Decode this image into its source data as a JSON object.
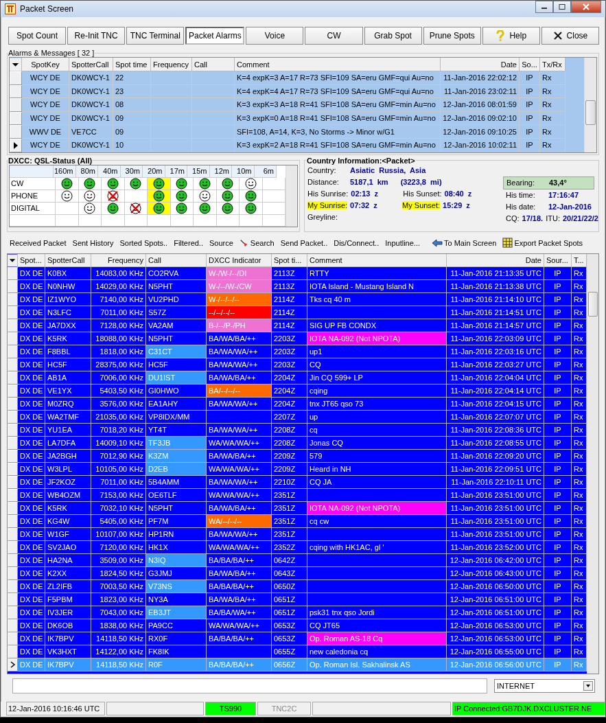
{
  "window": {
    "title": "Packet Screen"
  },
  "toolbar": [
    {
      "label": "Spot Count",
      "kind": "plain",
      "selected": false
    },
    {
      "label": "Re-Init TNC",
      "kind": "plain",
      "selected": false
    },
    {
      "label": "TNC Terminal",
      "kind": "plain",
      "selected": false
    },
    {
      "label": "Packet Alarms",
      "kind": "plain",
      "selected": true
    },
    {
      "label": "Voice",
      "kind": "plain",
      "selected": false
    },
    {
      "label": "CW",
      "kind": "plain",
      "selected": false
    },
    {
      "label": "Grab Spot",
      "kind": "plain",
      "selected": false
    },
    {
      "label": "Prune Spots",
      "kind": "plain",
      "selected": false
    },
    {
      "label": "Help",
      "kind": "help",
      "selected": false
    },
    {
      "label": "Close",
      "kind": "close",
      "selected": false
    }
  ],
  "alarms": {
    "title": "Alarms & Messages [ 32 ]",
    "columns": [
      "SpotKey",
      "SpotterCall",
      "Spot time",
      "Frequency",
      "Call",
      "Comment",
      "Date",
      "So...",
      "Tx/Rx"
    ],
    "rows": [
      {
        "cells": [
          "WCY DE",
          "DK0WCY-1",
          "22",
          "",
          "",
          "K=4 expK=3 A=17 R=73 SFI=109 SA=eru GMF=qui Au=no",
          "11-Jan-2016 22:02:12",
          "IP",
          "Rx"
        ],
        "selected": false
      },
      {
        "cells": [
          "WCY DE",
          "DK0WCY-1",
          "23",
          "",
          "",
          "K=4 expK=4 A=17 R=73 SFI=109 SA=eru GMF=qui Au=no",
          "11-Jan-2016 23:02:11",
          "IP",
          "Rx"
        ],
        "selected": false
      },
      {
        "cells": [
          "WCY DE",
          "DK0WCY-1",
          "08",
          "",
          "",
          "K=3 expK=3 A=18 R=41 SFI=108 SA=eru GMF=min Au=no",
          "12-Jan-2016 08:01:59",
          "IP",
          "Rx"
        ],
        "selected": false
      },
      {
        "cells": [
          "WCY DE",
          "DK0WCY-1",
          "09",
          "",
          "",
          "K=3 expK=0 A=18 R=41 SFI=108 SA=eru GMF=min Au=no",
          "12-Jan-2016 09:02:10",
          "IP",
          "Rx"
        ],
        "selected": false
      },
      {
        "cells": [
          "WWV DE",
          "VE7CC",
          "09",
          "",
          "",
          "SFI=108, A=14, K=3, No Storms -> Minor w/G1",
          "12-Jan-2016 09:10:25",
          "IP",
          "Rx"
        ],
        "selected": false
      },
      {
        "cells": [
          "WCY DE",
          "DK0WCY-1",
          "10",
          "",
          "",
          "K=3 expK=2 A=18 R=41 SFI=108 SA=eru GMF=min Au=no",
          "12-Jan-2016 10:02:11",
          "IP",
          "Rx"
        ],
        "selected": true
      }
    ]
  },
  "dxcc": {
    "title": "DXCC: QSL-Status  (All)",
    "bands": [
      {
        "label": "160m",
        "selected": false
      },
      {
        "label": "80m",
        "selected": false
      },
      {
        "label": "40m",
        "selected": false
      },
      {
        "label": "30m",
        "selected": false
      },
      {
        "label": "20m",
        "selected": true
      },
      {
        "label": "17m",
        "selected": false
      },
      {
        "label": "15m",
        "selected": false
      },
      {
        "label": "12m",
        "selected": false
      },
      {
        "label": "10m",
        "selected": false
      },
      {
        "label": "6m",
        "selected": false
      }
    ],
    "modes": [
      {
        "label": "CW",
        "cells": [
          {
            "kind": "confirmed"
          },
          {
            "kind": "confirmed"
          },
          {
            "kind": "confirmed"
          },
          {
            "kind": "confirmed"
          },
          {
            "kind": "confirmed"
          },
          {
            "kind": "confirmed"
          },
          {
            "kind": "confirmed"
          },
          {
            "kind": "confirmed"
          },
          {
            "kind": "worked"
          },
          {
            "kind": "empty"
          }
        ]
      },
      {
        "label": "PHONE",
        "cells": [
          {
            "kind": "worked"
          },
          {
            "kind": "worked"
          },
          {
            "kind": "missing"
          },
          {
            "kind": "empty"
          },
          {
            "kind": "confirmed"
          },
          {
            "kind": "confirmed"
          },
          {
            "kind": "worked"
          },
          {
            "kind": "confirmed"
          },
          {
            "kind": "confirmed"
          },
          {
            "kind": "empty"
          }
        ]
      },
      {
        "label": "DIGITAL",
        "cells": [
          {
            "kind": "empty"
          },
          {
            "kind": "worked"
          },
          {
            "kind": "confirmed"
          },
          {
            "kind": "missing"
          },
          {
            "kind": "confirmed"
          },
          {
            "kind": "confirmed"
          },
          {
            "kind": "confirmed"
          },
          {
            "kind": "confirmed"
          },
          {
            "kind": "confirmed"
          },
          {
            "kind": "empty"
          }
        ]
      }
    ]
  },
  "country_info": {
    "title": "Country Information:<Packet>",
    "country": {
      "label": "Country:",
      "value": "Asiatic  Russia,  Asia"
    },
    "distance": {
      "label": "Distance:",
      "value": "5187,1  km",
      "value_2": "(3223,8  mi)"
    },
    "his_sunrise": {
      "label": "His Sunrise:",
      "value": "02:13  z",
      "highlighted": false
    },
    "his_sunset": {
      "label": "His Sunset:",
      "value": "08:40  z",
      "highlighted": false
    },
    "my_sunrise": {
      "label": "My Sunrise:",
      "value": "07:32  z",
      "highlighted": true
    },
    "my_sunset": {
      "label": "My Sunset:",
      "value": "15:29  z",
      "highlighted": true
    },
    "greyline": {
      "label": "Greyline:"
    },
    "bearing": {
      "label": "Bearing:",
      "value": "43,4°"
    },
    "his_time": {
      "label": "His time:",
      "value": "17:16:47"
    },
    "his_date": {
      "label": "His date:",
      "value": "12-Jan-2016"
    },
    "cq": {
      "label": "CQ:",
      "value": "17/18."
    },
    "itu": {
      "label": "ITU:",
      "value": "20/21/22/2"
    }
  },
  "links": [
    {
      "label": "Received Packet",
      "kind": "plain"
    },
    {
      "label": "Sent History",
      "kind": "plain"
    },
    {
      "label": "Sorted Spots..",
      "kind": "plain"
    },
    {
      "label": "Filtered..",
      "kind": "plain"
    },
    {
      "label": "Source",
      "kind": "plain"
    },
    {
      "label": "Search",
      "kind": "search"
    },
    {
      "label": "Send Packet..",
      "kind": "plain"
    },
    {
      "label": "Dis/Connect..",
      "kind": "plain"
    },
    {
      "label": "Inputline...",
      "kind": "plain"
    },
    {
      "label": "To Main Screen",
      "kind": "back"
    },
    {
      "label": "Export Packet Spots",
      "kind": "export"
    }
  ],
  "spots": {
    "columns": [
      "Spot...",
      "SpotterCall",
      "Frequency",
      "Call",
      "DXCC Indicator",
      "Spot ti...",
      "Comment",
      "Date",
      "Sour...",
      "T..."
    ],
    "rows": [
      {
        "cells": [
          "DX DE",
          "K0BX",
          "14083,00 KHz",
          "CO2RVA",
          "W-/W-/--/DI",
          "2113Z",
          "RTTY",
          "11-Jan-2016 21:13:35 UTC",
          "IP",
          "Rx"
        ],
        "dxcc_cell": {
          "color": "#ee72d2"
        },
        "selected": false
      },
      {
        "cells": [
          "DX DE",
          "N0NHW",
          "14029,00 KHz",
          "N5PHT",
          "W-/--/W-/CW",
          "2113Z",
          "IOTA Island - Mustang Island N",
          "11-Jan-2016 21:13:38 UTC",
          "IP",
          "Rx"
        ],
        "dxcc_cell": {
          "color": "#ee72d2"
        },
        "selected": false
      },
      {
        "cells": [
          "DX DE",
          "IZ1WYO",
          "7140,00 KHz",
          "VU2PHD",
          "W-/--/--/--",
          "2114Z",
          "Tks cq 40 m",
          "11-Jan-2016 21:14:10 UTC",
          "IP",
          "Rx"
        ],
        "dxcc_cell": {
          "color": "#ff6a00"
        },
        "selected": false
      },
      {
        "cells": [
          "DX DE",
          "N3LFC",
          "7011,00 KHz",
          "S57Z",
          "--/--/--/--",
          "2114Z",
          "",
          "11-Jan-2016 21:14:51 UTC",
          "IP",
          "Rx"
        ],
        "dxcc_cell": {
          "color": "#ff0000"
        },
        "selected": false
      },
      {
        "cells": [
          "DX DE",
          "JA7DXX",
          "7128,00 KHz",
          "VA2AM",
          "B-/--/P-/PH",
          "2114Z",
          "SIG UP FB CONDX",
          "11-Jan-2016 21:14:57 UTC",
          "IP",
          "Rx"
        ],
        "dxcc_cell": {
          "color": "#ee72d2"
        },
        "selected": false
      },
      {
        "cells": [
          "DX DE",
          "K5RK",
          "18088,00 KHz",
          "N5PHT",
          "BA/WA/BA/++",
          "2203Z",
          "IOTA NA-092 (Not NPOTA)",
          "11-Jan-2016 22:03:09 UTC",
          "IP",
          "Rx"
        ],
        "comment_cell": {
          "color": "#ff00ff"
        },
        "selected": false
      },
      {
        "cells": [
          "DX DE",
          "F8BBL",
          "1818,00 KHz",
          "C31CT",
          "BA/WA/WA/++",
          "2203Z",
          "up1",
          "11-Jan-2016 22:03:16 UTC",
          "IP",
          "Rx"
        ],
        "call_cell": {
          "color": "#3399ff"
        },
        "selected": false
      },
      {
        "cells": [
          "DX DE",
          "HC5F",
          "28375,00 KHz",
          "HC5F",
          "BA/WA/WA/++",
          "2203Z",
          "CQ",
          "11-Jan-2016 22:03:27 UTC",
          "IP",
          "Rx"
        ],
        "selected": false
      },
      {
        "cells": [
          "DX DE",
          "AB1A",
          "7006,00 KHz",
          "DU1IST",
          "BA/WA/BA/++",
          "2204Z",
          "Jin CQ 599+ LP",
          "11-Jan-2016 22:04:04 UTC",
          "IP",
          "Rx"
        ],
        "call_cell": {
          "color": "#3399ff"
        },
        "selected": false
      },
      {
        "cells": [
          "DX DE",
          "VE1YX",
          "5403,50 KHz",
          "GI0HWO",
          "BA/--/--/--",
          "2204Z",
          "cqing",
          "11-Jan-2016 22:04:14 UTC",
          "IP",
          "Rx"
        ],
        "dxcc_cell": {
          "color": "#ff6a00"
        },
        "selected": false
      },
      {
        "cells": [
          "DX DE",
          "M0ZRQ",
          "3576,00 KHz",
          "EA1AHY",
          "BA/WA/WA/++",
          "2204Z",
          "tnx JT65 qso 73",
          "11-Jan-2016 22:04:15 UTC",
          "IP",
          "Rx"
        ],
        "selected": false
      },
      {
        "cells": [
          "DX DE",
          "WA2TMF",
          "21035,00 KHz",
          "VP8IDX/MM",
          "",
          "2207Z",
          "up",
          "11-Jan-2016 22:07:07 UTC",
          "IP",
          "Rx"
        ],
        "selected": false
      },
      {
        "cells": [
          "DX DE",
          "YU1EA",
          "7018,20 KHz",
          "YT4T",
          "BA/WA/WA/++",
          "2208Z",
          "cq",
          "11-Jan-2016 22:08:36 UTC",
          "IP",
          "Rx"
        ],
        "selected": false
      },
      {
        "cells": [
          "DX DE",
          "LA7DFA",
          "14009,10 KHz",
          "TF3JB",
          "WA/WA/WA/++",
          "2208Z",
          "Jonas CQ",
          "11-Jan-2016 22:08:55 UTC",
          "IP",
          "Rx"
        ],
        "call_cell": {
          "color": "#3399ff"
        },
        "selected": false
      },
      {
        "cells": [
          "DX DE",
          "JA2BGH",
          "7012,90 KHz",
          "K3ZM",
          "BA/WA/BA/++",
          "2209Z",
          "579",
          "11-Jan-2016 22:09:20 UTC",
          "IP",
          "Rx"
        ],
        "call_cell": {
          "color": "#3399ff"
        },
        "selected": false
      },
      {
        "cells": [
          "DX DE",
          "W3LPL",
          "10105,00 KHz",
          "D2EB",
          "WA/WA/WA/++",
          "2209Z",
          "Heard in NH",
          "11-Jan-2016 22:09:51 UTC",
          "IP",
          "Rx"
        ],
        "call_cell": {
          "color": "#3399ff"
        },
        "selected": false
      },
      {
        "cells": [
          "DX DE",
          "JF2KOZ",
          "7011,00 KHz",
          "5B4AMM",
          "BA/WA/WA/++",
          "2210Z",
          "CQ JA",
          "11-Jan-2016 22:10:11 UTC",
          "IP",
          "Rx"
        ],
        "selected": false
      },
      {
        "cells": [
          "DX DE",
          "WB4OZM",
          "7153,00 KHz",
          "OE6TLF",
          "WA/WA/WA/++",
          "2351Z",
          "",
          "11-Jan-2016 23:51:00 UTC",
          "IP",
          "Rx"
        ],
        "selected": false
      },
      {
        "cells": [
          "DX DE",
          "K5RK",
          "7032,10 KHz",
          "N5PHT",
          "BA/WA/BA/++",
          "2351Z",
          "IOTA NA-092 (Not NPOTA)",
          "11-Jan-2016 23:51:00 UTC",
          "IP",
          "Rx"
        ],
        "comment_cell": {
          "color": "#ff00ff"
        },
        "selected": false
      },
      {
        "cells": [
          "DX DE",
          "KG4W",
          "5405,00 KHz",
          "PF7M",
          "WA/--/--/--",
          "2351Z",
          "cq cw",
          "11-Jan-2016 23:51:00 UTC",
          "IP",
          "Rx"
        ],
        "dxcc_cell": {
          "color": "#ff6a00"
        },
        "selected": false
      },
      {
        "cells": [
          "DX DE",
          "W1GF",
          "10107,00 KHz",
          "HP1RN",
          "BA/WA/WA/++",
          "2351Z",
          "",
          "11-Jan-2016 23:51:00 UTC",
          "IP",
          "Rx"
        ],
        "selected": false
      },
      {
        "cells": [
          "DX DE",
          "SV2JAO",
          "7120,00 KHz",
          "HK1X",
          "WA/WA/WA/++",
          "2352Z",
          "cqing with HK1AC, gl '",
          "11-Jan-2016 23:52:00 UTC",
          "IP",
          "Rx"
        ],
        "selected": false
      },
      {
        "cells": [
          "DX DE",
          "HA2NA",
          "3509,00 KHz",
          "N3IQ",
          "BA/BA/BA/++",
          "0642Z",
          "",
          "12-Jan-2016 06:42:00 UTC",
          "IP",
          "Rx"
        ],
        "call_cell": {
          "color": "#3399ff"
        },
        "selected": false
      },
      {
        "cells": [
          "DX DE",
          "K2XX",
          "1824,50 KHz",
          "G3JMJ",
          "BA/WA/BA/++",
          "0643Z",
          "",
          "12-Jan-2016 06:43:00 UTC",
          "IP",
          "Rx"
        ],
        "selected": false
      },
      {
        "cells": [
          "DX DE",
          "ZL2IFB",
          "7003,50 KHz",
          "V73NS",
          "BA/BA/BA/++",
          "0650Z",
          "",
          "12-Jan-2016 06:50:00 UTC",
          "IP",
          "Rx"
        ],
        "call_cell": {
          "color": "#3399ff"
        },
        "selected": false
      },
      {
        "cells": [
          "DX DE",
          "F5PBM",
          "1823,00 KHz",
          "NY3A",
          "BA/WA/BA/++",
          "0651Z",
          "",
          "12-Jan-2016 06:51:00 UTC",
          "IP",
          "Rx"
        ],
        "selected": false
      },
      {
        "cells": [
          "DX DE",
          "IV3JER",
          "7043,00 KHz",
          "EB3JT",
          "BA/BA/WA/++",
          "0651Z",
          "psk31 tnx qso Jordi",
          "12-Jan-2016 06:51:00 UTC",
          "IP",
          "Rx"
        ],
        "call_cell": {
          "color": "#3399ff"
        },
        "selected": false
      },
      {
        "cells": [
          "DX DE",
          "DK6OB",
          "1838,00 KHz",
          "PA9CC",
          "WA/WA/WA/++",
          "0653Z",
          "CQ JT65",
          "12-Jan-2016 06:53:00 UTC",
          "IP",
          "Rx"
        ],
        "selected": false
      },
      {
        "cells": [
          "DX DE",
          "IK7BPV",
          "14118,50 KHz",
          "RX0F",
          "BA/BA/BA/++",
          "0653Z",
          "Op. Roman AS-18 Cq",
          "12-Jan-2016 06:53:00 UTC",
          "IP",
          "Rx"
        ],
        "comment_cell": {
          "color": "#ff00ff"
        },
        "selected": false
      },
      {
        "cells": [
          "DX DE",
          "VK3HXT",
          "14122,00 KHz",
          "FK8IK",
          "",
          "0655Z",
          "new caledonia cq",
          "12-Jan-2016 06:55:00 UTC",
          "IP",
          "Rx"
        ],
        "selected": false
      },
      {
        "cells": [
          "DX DE",
          "IK7BPV",
          "14118,50 KHz",
          "R0F",
          "BA/BA/BA/++",
          "0656Z",
          "Op. Roman Isl. Sakhalinsk AS",
          "12-Jan-2016 06:56:00 UTC",
          "IP",
          "Rx"
        ],
        "selected": true
      }
    ]
  },
  "inputline": {
    "source": "INTERNET"
  },
  "status_bar": {
    "clock": {
      "text": "12-Jan-2016  10:16:46 UTC"
    },
    "radio": {
      "text": "TS990",
      "color": "#00ff00"
    },
    "tnc": {
      "text": "TNC2C",
      "disabled": true
    },
    "connection": {
      "text": "IP Connected:GB7DJK.DXCLUSTER.NE",
      "color": "#00ff00"
    }
  }
}
